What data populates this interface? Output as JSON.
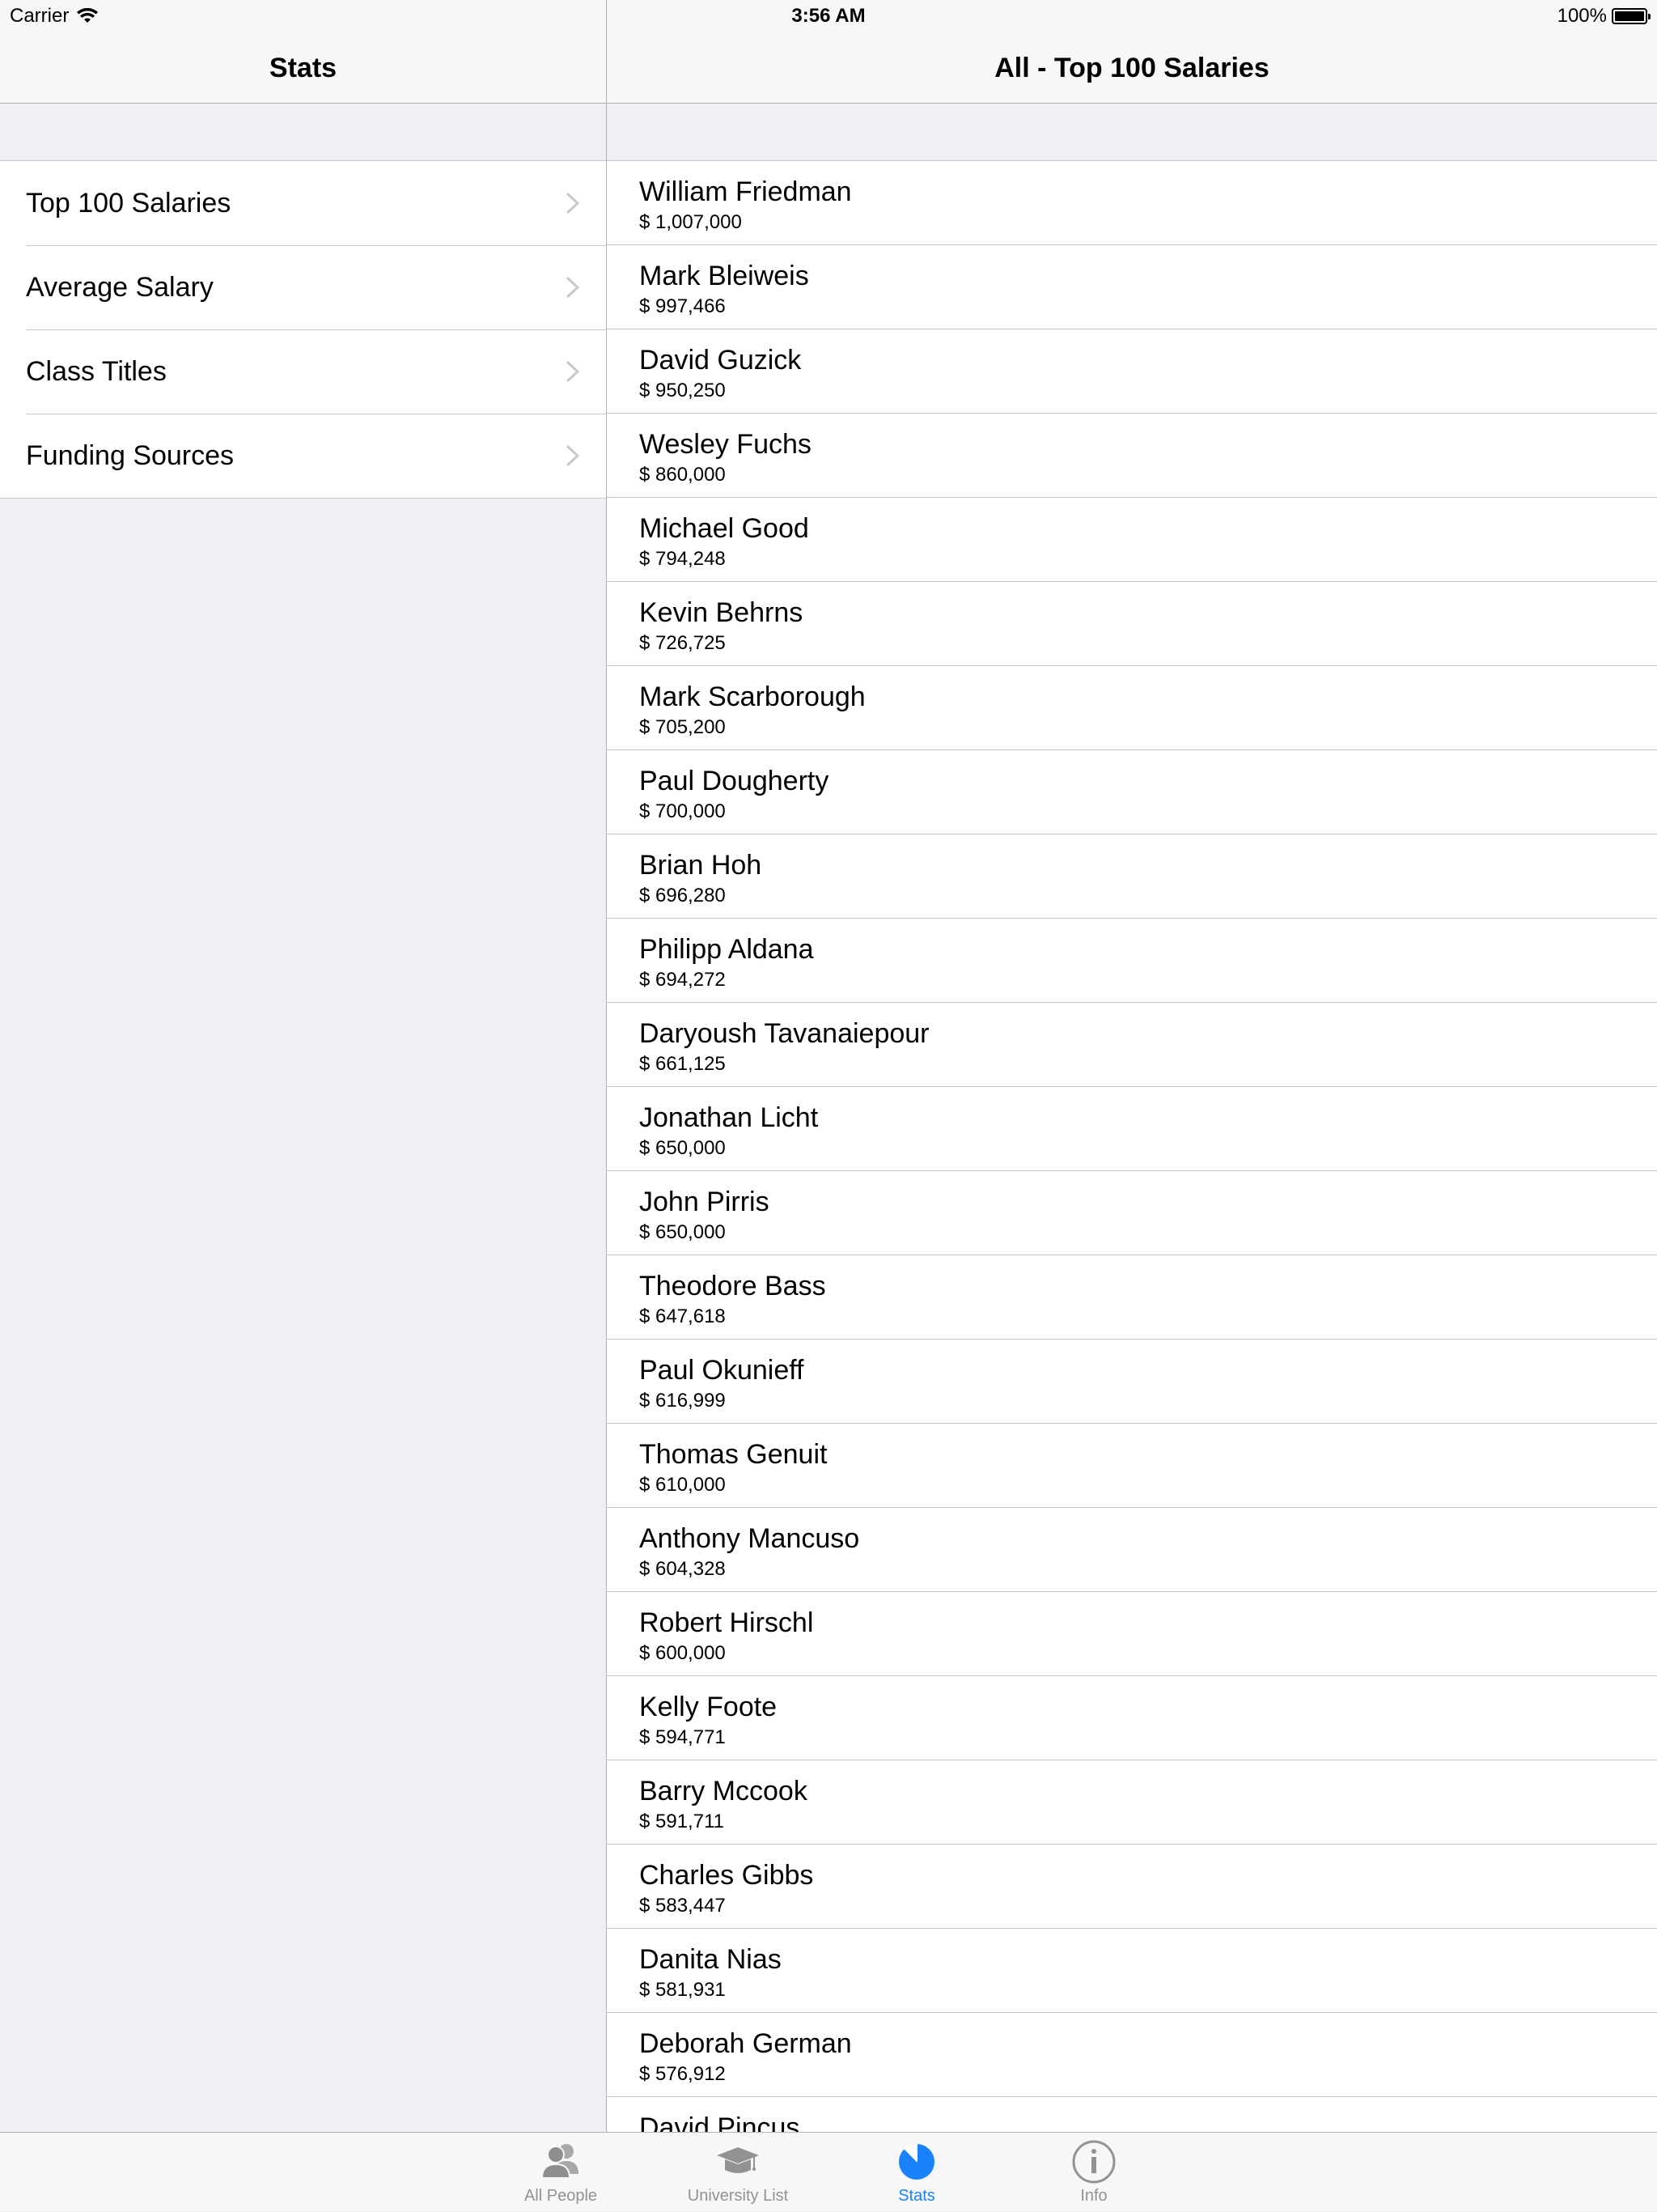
{
  "status_bar": {
    "carrier": "Carrier",
    "time": "3:56 AM",
    "battery": "100%"
  },
  "master": {
    "title": "Stats",
    "items": [
      {
        "label": "Top 100 Salaries"
      },
      {
        "label": "Average Salary"
      },
      {
        "label": "Class Titles"
      },
      {
        "label": "Funding Sources"
      }
    ]
  },
  "detail": {
    "title": "All - Top 100 Salaries",
    "people": [
      {
        "name": "William Friedman",
        "salary": "$ 1,007,000"
      },
      {
        "name": "Mark Bleiweis",
        "salary": "$ 997,466"
      },
      {
        "name": "David Guzick",
        "salary": "$ 950,250"
      },
      {
        "name": "Wesley Fuchs",
        "salary": "$ 860,000"
      },
      {
        "name": "Michael Good",
        "salary": "$ 794,248"
      },
      {
        "name": "Kevin Behrns",
        "salary": "$ 726,725"
      },
      {
        "name": "Mark Scarborough",
        "salary": "$ 705,200"
      },
      {
        "name": "Paul Dougherty",
        "salary": "$ 700,000"
      },
      {
        "name": "Brian Hoh",
        "salary": "$ 696,280"
      },
      {
        "name": "Philipp Aldana",
        "salary": "$ 694,272"
      },
      {
        "name": "Daryoush Tavanaiepour",
        "salary": "$ 661,125"
      },
      {
        "name": "Jonathan Licht",
        "salary": "$ 650,000"
      },
      {
        "name": "John Pirris",
        "salary": "$ 650,000"
      },
      {
        "name": "Theodore Bass",
        "salary": "$ 647,618"
      },
      {
        "name": "Paul Okunieff",
        "salary": "$ 616,999"
      },
      {
        "name": "Thomas Genuit",
        "salary": "$ 610,000"
      },
      {
        "name": "Anthony Mancuso",
        "salary": "$ 604,328"
      },
      {
        "name": "Robert Hirschl",
        "salary": "$ 600,000"
      },
      {
        "name": "Kelly Foote",
        "salary": "$ 594,771"
      },
      {
        "name": "Barry Mccook",
        "salary": "$ 591,711"
      },
      {
        "name": "Charles Gibbs",
        "salary": "$ 583,447"
      },
      {
        "name": "Danita Nias",
        "salary": "$ 581,931"
      },
      {
        "name": "Deborah German",
        "salary": "$ 576,912"
      },
      {
        "name": "David Pincus",
        "salary": ""
      }
    ]
  },
  "tab_bar": {
    "accent_color": "#1a82fb",
    "inactive_color": "#929292",
    "active_tab": "Stats",
    "tabs": [
      {
        "label": "All People",
        "icon": "people-icon"
      },
      {
        "label": "University List",
        "icon": "graduation-cap-icon"
      },
      {
        "label": "Stats",
        "icon": "pie-chart-icon"
      },
      {
        "label": "Info",
        "icon": "info-icon"
      }
    ]
  }
}
